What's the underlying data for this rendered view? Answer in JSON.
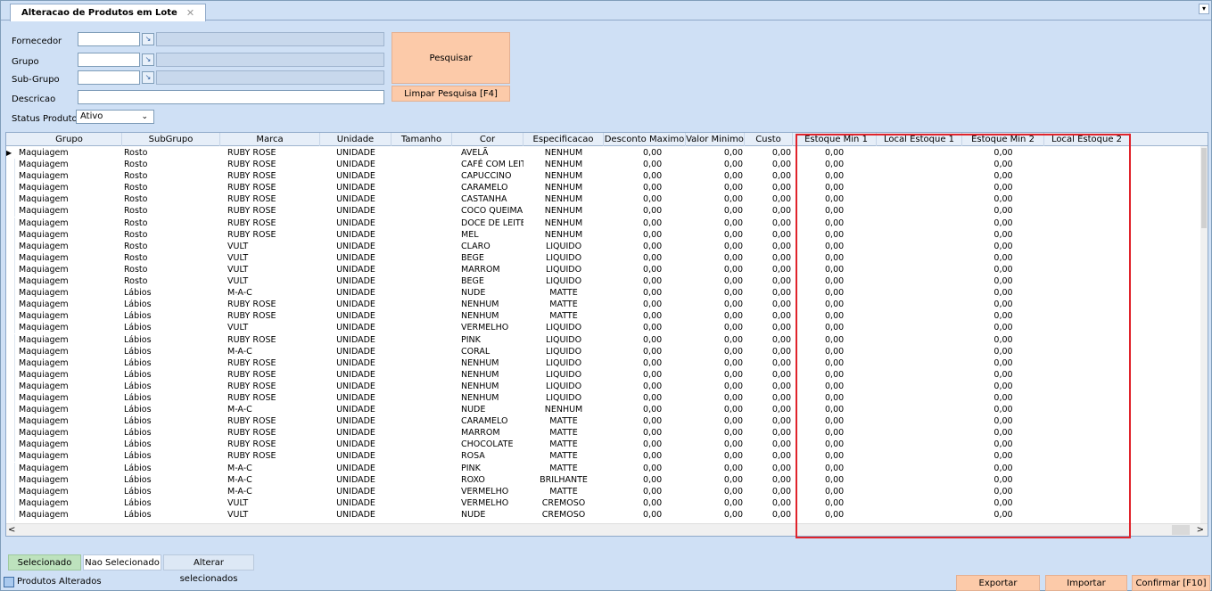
{
  "tab": {
    "title": "Alteracao de Produtos em Lote",
    "close": "✕"
  },
  "filters": {
    "fornecedor_label": "Fornecedor",
    "grupo_label": "Grupo",
    "subgrupo_label": "Sub-Grupo",
    "descricao_label": "Descricao",
    "status_label": "Status Produto",
    "status_value": "Ativo",
    "search_button": "Pesquisar",
    "clear_button": "Limpar Pesquisa [F4]"
  },
  "grid": {
    "columns": [
      "Grupo",
      "SubGrupo",
      "Marca",
      "Unidade",
      "Tamanho",
      "Cor",
      "Especificacao",
      "Desconto Maximo",
      "Valor Minimo",
      "Custo",
      "Estoque Min 1",
      "Local Estoque 1",
      "Estoque Min 2",
      "Local Estoque 2"
    ],
    "rows": [
      [
        "Maquiagem",
        "Rosto",
        "RUBY ROSE",
        "UNIDADE",
        "",
        "AVELÃ",
        "NENHUM",
        "0,00",
        "0,00",
        "0,00",
        "0,00",
        "",
        "0,00",
        ""
      ],
      [
        "Maquiagem",
        "Rosto",
        "RUBY ROSE",
        "UNIDADE",
        "",
        "CAFÉ COM LEITE",
        "NENHUM",
        "0,00",
        "0,00",
        "0,00",
        "0,00",
        "",
        "0,00",
        ""
      ],
      [
        "Maquiagem",
        "Rosto",
        "RUBY ROSE",
        "UNIDADE",
        "",
        "CAPUCCINO",
        "NENHUM",
        "0,00",
        "0,00",
        "0,00",
        "0,00",
        "",
        "0,00",
        ""
      ],
      [
        "Maquiagem",
        "Rosto",
        "RUBY ROSE",
        "UNIDADE",
        "",
        "CARAMELO",
        "NENHUM",
        "0,00",
        "0,00",
        "0,00",
        "0,00",
        "",
        "0,00",
        ""
      ],
      [
        "Maquiagem",
        "Rosto",
        "RUBY ROSE",
        "UNIDADE",
        "",
        "CASTANHA",
        "NENHUM",
        "0,00",
        "0,00",
        "0,00",
        "0,00",
        "",
        "0,00",
        ""
      ],
      [
        "Maquiagem",
        "Rosto",
        "RUBY ROSE",
        "UNIDADE",
        "",
        "COCO QUEIMADO",
        "NENHUM",
        "0,00",
        "0,00",
        "0,00",
        "0,00",
        "",
        "0,00",
        ""
      ],
      [
        "Maquiagem",
        "Rosto",
        "RUBY ROSE",
        "UNIDADE",
        "",
        "DOCE DE LEITE",
        "NENHUM",
        "0,00",
        "0,00",
        "0,00",
        "0,00",
        "",
        "0,00",
        ""
      ],
      [
        "Maquiagem",
        "Rosto",
        "RUBY ROSE",
        "UNIDADE",
        "",
        "MEL",
        "NENHUM",
        "0,00",
        "0,00",
        "0,00",
        "0,00",
        "",
        "0,00",
        ""
      ],
      [
        "Maquiagem",
        "Rosto",
        "VULT",
        "UNIDADE",
        "",
        "CLARO",
        "LIQUIDO",
        "0,00",
        "0,00",
        "0,00",
        "0,00",
        "",
        "0,00",
        ""
      ],
      [
        "Maquiagem",
        "Rosto",
        "VULT",
        "UNIDADE",
        "",
        "BEGE",
        "LIQUIDO",
        "0,00",
        "0,00",
        "0,00",
        "0,00",
        "",
        "0,00",
        ""
      ],
      [
        "Maquiagem",
        "Rosto",
        "VULT",
        "UNIDADE",
        "",
        "MARROM",
        "LIQUIDO",
        "0,00",
        "0,00",
        "0,00",
        "0,00",
        "",
        "0,00",
        ""
      ],
      [
        "Maquiagem",
        "Rosto",
        "VULT",
        "UNIDADE",
        "",
        "BEGE",
        "LIQUIDO",
        "0,00",
        "0,00",
        "0,00",
        "0,00",
        "",
        "0,00",
        ""
      ],
      [
        "Maquiagem",
        "Lábios",
        "M-A-C",
        "UNIDADE",
        "",
        "NUDE",
        "MATTE",
        "0,00",
        "0,00",
        "0,00",
        "0,00",
        "",
        "0,00",
        ""
      ],
      [
        "Maquiagem",
        "Lábios",
        "RUBY ROSE",
        "UNIDADE",
        "",
        "NENHUM",
        "MATTE",
        "0,00",
        "0,00",
        "0,00",
        "0,00",
        "",
        "0,00",
        ""
      ],
      [
        "Maquiagem",
        "Lábios",
        "RUBY ROSE",
        "UNIDADE",
        "",
        "NENHUM",
        "MATTE",
        "0,00",
        "0,00",
        "0,00",
        "0,00",
        "",
        "0,00",
        ""
      ],
      [
        "Maquiagem",
        "Lábios",
        "VULT",
        "UNIDADE",
        "",
        "VERMELHO",
        "LIQUIDO",
        "0,00",
        "0,00",
        "0,00",
        "0,00",
        "",
        "0,00",
        ""
      ],
      [
        "Maquiagem",
        "Lábios",
        "RUBY ROSE",
        "UNIDADE",
        "",
        "PINK",
        "LIQUIDO",
        "0,00",
        "0,00",
        "0,00",
        "0,00",
        "",
        "0,00",
        ""
      ],
      [
        "Maquiagem",
        "Lábios",
        "M-A-C",
        "UNIDADE",
        "",
        "CORAL",
        "LIQUIDO",
        "0,00",
        "0,00",
        "0,00",
        "0,00",
        "",
        "0,00",
        ""
      ],
      [
        "Maquiagem",
        "Lábios",
        "RUBY ROSE",
        "UNIDADE",
        "",
        "NENHUM",
        "LIQUIDO",
        "0,00",
        "0,00",
        "0,00",
        "0,00",
        "",
        "0,00",
        ""
      ],
      [
        "Maquiagem",
        "Lábios",
        "RUBY ROSE",
        "UNIDADE",
        "",
        "NENHUM",
        "LIQUIDO",
        "0,00",
        "0,00",
        "0,00",
        "0,00",
        "",
        "0,00",
        ""
      ],
      [
        "Maquiagem",
        "Lábios",
        "RUBY ROSE",
        "UNIDADE",
        "",
        "NENHUM",
        "LIQUIDO",
        "0,00",
        "0,00",
        "0,00",
        "0,00",
        "",
        "0,00",
        ""
      ],
      [
        "Maquiagem",
        "Lábios",
        "RUBY ROSE",
        "UNIDADE",
        "",
        "NENHUM",
        "LIQUIDO",
        "0,00",
        "0,00",
        "0,00",
        "0,00",
        "",
        "0,00",
        ""
      ],
      [
        "Maquiagem",
        "Lábios",
        "M-A-C",
        "UNIDADE",
        "",
        "NUDE",
        "NENHUM",
        "0,00",
        "0,00",
        "0,00",
        "0,00",
        "",
        "0,00",
        ""
      ],
      [
        "Maquiagem",
        "Lábios",
        "RUBY ROSE",
        "UNIDADE",
        "",
        "CARAMELO",
        "MATTE",
        "0,00",
        "0,00",
        "0,00",
        "0,00",
        "",
        "0,00",
        ""
      ],
      [
        "Maquiagem",
        "Lábios",
        "RUBY ROSE",
        "UNIDADE",
        "",
        "MARROM",
        "MATTE",
        "0,00",
        "0,00",
        "0,00",
        "0,00",
        "",
        "0,00",
        ""
      ],
      [
        "Maquiagem",
        "Lábios",
        "RUBY ROSE",
        "UNIDADE",
        "",
        "CHOCOLATE",
        "MATTE",
        "0,00",
        "0,00",
        "0,00",
        "0,00",
        "",
        "0,00",
        ""
      ],
      [
        "Maquiagem",
        "Lábios",
        "RUBY ROSE",
        "UNIDADE",
        "",
        "ROSA",
        "MATTE",
        "0,00",
        "0,00",
        "0,00",
        "0,00",
        "",
        "0,00",
        ""
      ],
      [
        "Maquiagem",
        "Lábios",
        "M-A-C",
        "UNIDADE",
        "",
        "PINK",
        "MATTE",
        "0,00",
        "0,00",
        "0,00",
        "0,00",
        "",
        "0,00",
        ""
      ],
      [
        "Maquiagem",
        "Lábios",
        "M-A-C",
        "UNIDADE",
        "",
        "ROXO",
        "BRILHANTE",
        "0,00",
        "0,00",
        "0,00",
        "0,00",
        "",
        "0,00",
        ""
      ],
      [
        "Maquiagem",
        "Lábios",
        "M-A-C",
        "UNIDADE",
        "",
        "VERMELHO",
        "MATTE",
        "0,00",
        "0,00",
        "0,00",
        "0,00",
        "",
        "0,00",
        ""
      ],
      [
        "Maquiagem",
        "Lábios",
        "VULT",
        "UNIDADE",
        "",
        "VERMELHO",
        "CREMOSO",
        "0,00",
        "0,00",
        "0,00",
        "0,00",
        "",
        "0,00",
        ""
      ],
      [
        "Maquiagem",
        "Lábios",
        "VULT",
        "UNIDADE",
        "",
        "NUDE",
        "CREMOSO",
        "0,00",
        "0,00",
        "0,00",
        "0,00",
        "",
        "0,00",
        ""
      ]
    ],
    "scroll_left": "<",
    "scroll_right": ">"
  },
  "selection_tabs": {
    "selected": "Selecionado",
    "not_selected": "Nao Selecionado",
    "alter": "Alterar selecionados"
  },
  "footer": {
    "legend": "Produtos Alterados",
    "export": "Exportar",
    "import": "Importar",
    "confirm": "Confirmar [F10]"
  },
  "colors": {
    "background": "#cfe0f5",
    "accent_button": "#fccaa9",
    "highlight": "#e0232b",
    "selected_tab": "#bde2bd"
  }
}
